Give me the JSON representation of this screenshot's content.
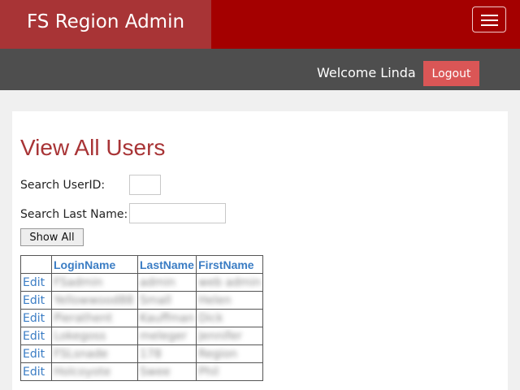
{
  "header": {
    "brand": "FS Region Admin",
    "menu_icon": "hamburger-icon",
    "accent_color": "#a40000"
  },
  "userbar": {
    "welcome": "Welcome Linda",
    "logout_label": "Logout"
  },
  "main": {
    "title": "View All Users",
    "search_userid_label": "Search UserID:",
    "search_userid_value": "",
    "search_lastname_label": "Search Last Name:",
    "search_lastname_value": "",
    "show_all_label": "Show All",
    "table": {
      "columns": [
        "",
        "LoginName",
        "LastName",
        "FirstName"
      ],
      "rows": [
        {
          "edit": "Edit",
          "login": "FSadmin",
          "last": "admin",
          "first": "web admin"
        },
        {
          "edit": "Edit",
          "login": "Yellowwood88",
          "last": "Small",
          "first": "Helen"
        },
        {
          "edit": "Edit",
          "login": "Pierathent",
          "last": "Kauffman",
          "first": "Dick"
        },
        {
          "edit": "Edit",
          "login": "Lokegoss",
          "last": "meleger",
          "first": "Jennifer"
        },
        {
          "edit": "Edit",
          "login": "FSLsnade",
          "last": "178",
          "first": "Region"
        },
        {
          "edit": "Edit",
          "login": "Holcoyote",
          "last": "Swee",
          "first": "Phil"
        }
      ]
    }
  }
}
